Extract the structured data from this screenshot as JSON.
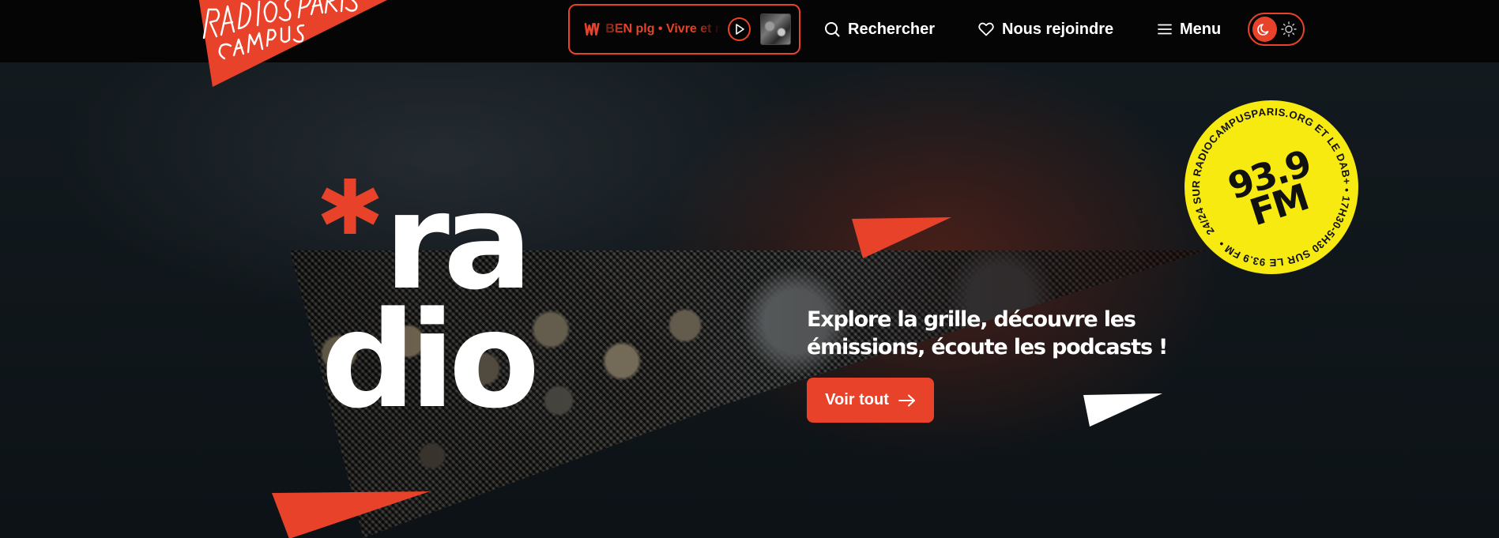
{
  "header": {
    "logo_text": [
      "RADIO",
      "CAMPUS",
      "PARIS"
    ],
    "player": {
      "now_playing": "BEN plg • Vivre et mourir",
      "wave_icon": "radio-wave-icon",
      "play_icon": "play-icon"
    },
    "nav": {
      "search_label": "Rechercher",
      "join_label": "Nous rejoindre",
      "menu_label": "Menu"
    },
    "theme_toggle": {
      "dark_icon": "moon-icon",
      "light_icon": "sun-icon",
      "active": "dark"
    }
  },
  "hero": {
    "word_top": "ra",
    "word_bottom": "dio",
    "asterisk": "*",
    "tagline": "Explore la grille, découvre les émissions, écoute les podcasts !",
    "cta_label": "Voir tout",
    "cta_icon": "arrow-right-icon"
  },
  "badge": {
    "frequency": "93.9",
    "band": "FM",
    "ring_text": "24/24 SUR RADIOCAMPUSPARIS.ORG ET LE DAB+ • 17H30-5H30 SUR LE 93.9 FM •"
  },
  "colors": {
    "accent": "#e8432a",
    "badge_yellow": "#f7ea10",
    "header_bg": "#050505",
    "page_bg": "#0e1418"
  }
}
